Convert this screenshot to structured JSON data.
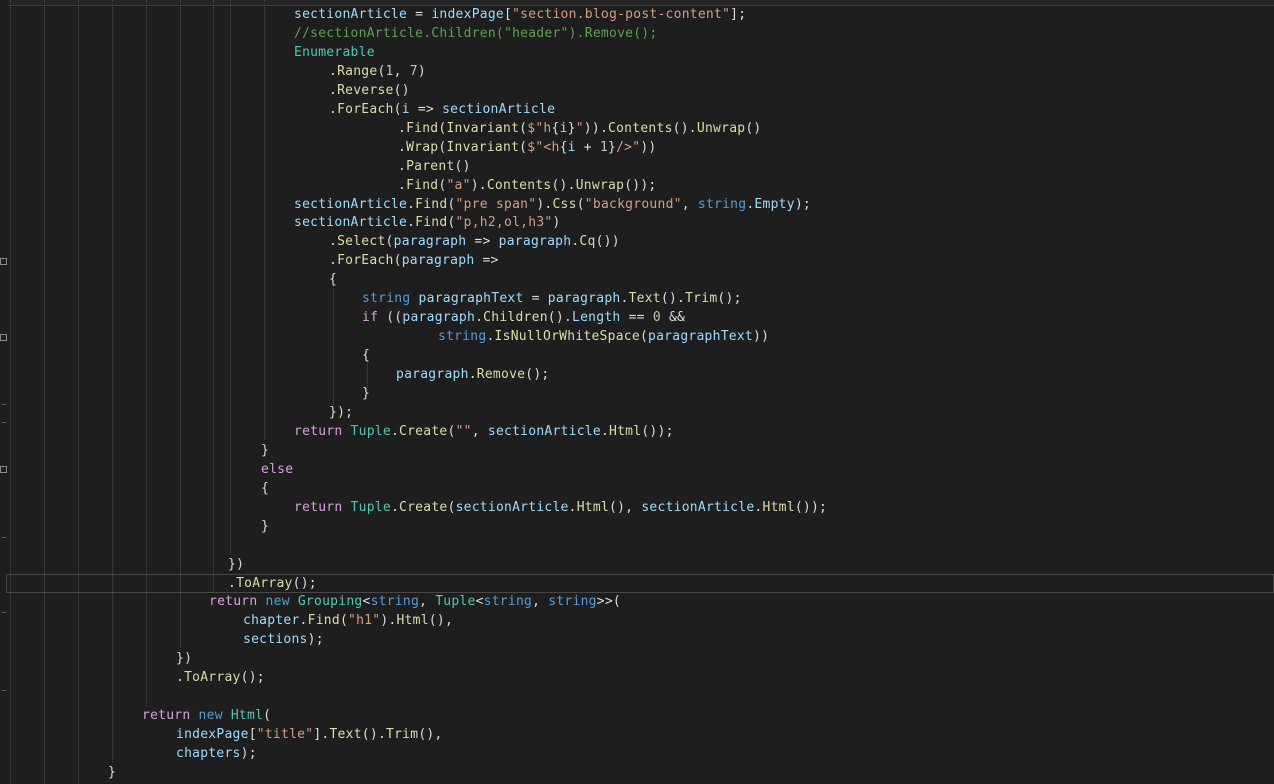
{
  "editor": {
    "theme": {
      "background": "#1e1e1e",
      "keyword": "#569cd6",
      "control": "#d8a0df",
      "string": "#d69d85",
      "comment": "#57a64a",
      "type": "#4ec9b0",
      "variable": "#9cdcfe",
      "method": "#dcdcaa",
      "number": "#b5cea8",
      "plain": "#dcdcdc"
    },
    "lines": [
      {
        "i": 0,
        "t": [
          [
            "var",
            "sectionArticle"
          ],
          [
            "p",
            " = "
          ],
          [
            "var",
            "indexPage"
          ],
          [
            "p",
            "["
          ],
          [
            "str",
            "\"section.blog-post-content\""
          ],
          [
            "p",
            "];"
          ]
        ]
      },
      {
        "i": 0,
        "t": [
          [
            "cmt",
            "//sectionArticle.Children(\"header\").Remove();"
          ]
        ]
      },
      {
        "i": 0,
        "t": [
          [
            "type",
            "Enumerable"
          ]
        ]
      },
      {
        "i": 1,
        "t": [
          [
            "p",
            "."
          ],
          [
            "meth",
            "Range"
          ],
          [
            "p",
            "("
          ],
          [
            "num",
            "1"
          ],
          [
            "p",
            ", "
          ],
          [
            "num",
            "7"
          ],
          [
            "p",
            ")"
          ]
        ]
      },
      {
        "i": 1,
        "t": [
          [
            "p",
            "."
          ],
          [
            "meth",
            "Reverse"
          ],
          [
            "p",
            "()"
          ]
        ]
      },
      {
        "i": 1,
        "t": [
          [
            "p",
            "."
          ],
          [
            "meth",
            "ForEach"
          ],
          [
            "p",
            "("
          ],
          [
            "var",
            "i"
          ],
          [
            "p",
            " => "
          ],
          [
            "var",
            "sectionArticle"
          ]
        ]
      },
      {
        "i": 2,
        "t": [
          [
            "p",
            "."
          ],
          [
            "meth",
            "Find"
          ],
          [
            "p",
            "("
          ],
          [
            "meth",
            "Invariant"
          ],
          [
            "p",
            "("
          ],
          [
            "str",
            "$\"h"
          ],
          [
            "p",
            "{"
          ],
          [
            "var",
            "i"
          ],
          [
            "p",
            "}"
          ],
          [
            "str",
            "\""
          ],
          [
            "p",
            "))."
          ],
          [
            "meth",
            "Contents"
          ],
          [
            "p",
            "()."
          ],
          [
            "meth",
            "Unwrap"
          ],
          [
            "p",
            "()"
          ]
        ]
      },
      {
        "i": 2,
        "t": [
          [
            "p",
            "."
          ],
          [
            "meth",
            "Wrap"
          ],
          [
            "p",
            "("
          ],
          [
            "meth",
            "Invariant"
          ],
          [
            "p",
            "("
          ],
          [
            "str",
            "$\"<h"
          ],
          [
            "p",
            "{"
          ],
          [
            "var",
            "i"
          ],
          [
            "p",
            " + "
          ],
          [
            "num",
            "1"
          ],
          [
            "p",
            "}"
          ],
          [
            "str",
            "/>\""
          ],
          [
            "p",
            "))"
          ]
        ]
      },
      {
        "i": 2,
        "t": [
          [
            "p",
            "."
          ],
          [
            "meth",
            "Parent"
          ],
          [
            "p",
            "()"
          ]
        ]
      },
      {
        "i": 2,
        "t": [
          [
            "p",
            "."
          ],
          [
            "meth",
            "Find"
          ],
          [
            "p",
            "("
          ],
          [
            "str",
            "\"a\""
          ],
          [
            "p",
            ")."
          ],
          [
            "meth",
            "Contents"
          ],
          [
            "p",
            "()."
          ],
          [
            "meth",
            "Unwrap"
          ],
          [
            "p",
            "());"
          ]
        ]
      },
      {
        "i": 0,
        "t": [
          [
            "var",
            "sectionArticle"
          ],
          [
            "p",
            "."
          ],
          [
            "meth",
            "Find"
          ],
          [
            "p",
            "("
          ],
          [
            "str",
            "\"pre span\""
          ],
          [
            "p",
            ")."
          ],
          [
            "meth",
            "Css"
          ],
          [
            "p",
            "("
          ],
          [
            "str",
            "\"background\""
          ],
          [
            "p",
            ", "
          ],
          [
            "kw",
            "string"
          ],
          [
            "p",
            "."
          ],
          [
            "var",
            "Empty"
          ],
          [
            "p",
            ");"
          ]
        ]
      },
      {
        "i": 0,
        "t": [
          [
            "var",
            "sectionArticle"
          ],
          [
            "p",
            "."
          ],
          [
            "meth",
            "Find"
          ],
          [
            "p",
            "("
          ],
          [
            "str",
            "\"p,h2,ol,h3\""
          ],
          [
            "p",
            ")"
          ]
        ]
      },
      {
        "i": 1,
        "t": [
          [
            "p",
            "."
          ],
          [
            "meth",
            "Select"
          ],
          [
            "p",
            "("
          ],
          [
            "var",
            "paragraph"
          ],
          [
            "p",
            " => "
          ],
          [
            "var",
            "paragraph"
          ],
          [
            "p",
            "."
          ],
          [
            "meth",
            "Cq"
          ],
          [
            "p",
            "())"
          ]
        ]
      },
      {
        "i": 1,
        "t": [
          [
            "p",
            "."
          ],
          [
            "meth",
            "ForEach"
          ],
          [
            "p",
            "("
          ],
          [
            "var",
            "paragraph"
          ],
          [
            "p",
            " =>"
          ]
        ]
      },
      {
        "i": 1,
        "t": [
          [
            "p",
            "{"
          ]
        ]
      },
      {
        "i": 3,
        "t": [
          [
            "kw",
            "string"
          ],
          [
            "p",
            " "
          ],
          [
            "var",
            "paragraphText"
          ],
          [
            "p",
            " = "
          ],
          [
            "var",
            "paragraph"
          ],
          [
            "p",
            "."
          ],
          [
            "meth",
            "Text"
          ],
          [
            "p",
            "()."
          ],
          [
            "meth",
            "Trim"
          ],
          [
            "p",
            "();"
          ]
        ]
      },
      {
        "i": 3,
        "t": [
          [
            "ctl",
            "if"
          ],
          [
            "p",
            " (("
          ],
          [
            "var",
            "paragraph"
          ],
          [
            "p",
            "."
          ],
          [
            "meth",
            "Children"
          ],
          [
            "p",
            "()."
          ],
          [
            "var",
            "Length"
          ],
          [
            "p",
            " == "
          ],
          [
            "num",
            "0"
          ],
          [
            "p",
            " &&"
          ]
        ]
      },
      {
        "i": 4,
        "t": [
          [
            "kw",
            "string"
          ],
          [
            "p",
            "."
          ],
          [
            "meth",
            "IsNullOrWhiteSpace"
          ],
          [
            "p",
            "("
          ],
          [
            "var",
            "paragraphText"
          ],
          [
            "p",
            "))"
          ]
        ]
      },
      {
        "i": 3,
        "t": [
          [
            "p",
            "{"
          ]
        ]
      },
      {
        "i": 5,
        "t": [
          [
            "var",
            "paragraph"
          ],
          [
            "p",
            "."
          ],
          [
            "meth",
            "Remove"
          ],
          [
            "p",
            "();"
          ]
        ]
      },
      {
        "i": 3,
        "t": [
          [
            "p",
            "}"
          ]
        ]
      },
      {
        "i": 1,
        "t": [
          [
            "p",
            "});"
          ]
        ]
      },
      {
        "i": 0,
        "t": [
          [
            "ctl",
            "return"
          ],
          [
            "p",
            " "
          ],
          [
            "type",
            "Tuple"
          ],
          [
            "p",
            "."
          ],
          [
            "meth",
            "Create"
          ],
          [
            "p",
            "("
          ],
          [
            "str",
            "\"\""
          ],
          [
            "p",
            ", "
          ],
          [
            "var",
            "sectionArticle"
          ],
          [
            "p",
            "."
          ],
          [
            "meth",
            "Html"
          ],
          [
            "p",
            "());"
          ]
        ]
      },
      {
        "i": 6,
        "t": [
          [
            "p",
            "}"
          ]
        ]
      },
      {
        "i": 6,
        "t": [
          [
            "ctl",
            "else"
          ]
        ]
      },
      {
        "i": 6,
        "t": [
          [
            "p",
            "{"
          ]
        ]
      },
      {
        "i": 0,
        "t": [
          [
            "ctl",
            "return"
          ],
          [
            "p",
            " "
          ],
          [
            "type",
            "Tuple"
          ],
          [
            "p",
            "."
          ],
          [
            "meth",
            "Create"
          ],
          [
            "p",
            "("
          ],
          [
            "var",
            "sectionArticle"
          ],
          [
            "p",
            "."
          ],
          [
            "meth",
            "Html"
          ],
          [
            "p",
            "(), "
          ],
          [
            "var",
            "sectionArticle"
          ],
          [
            "p",
            "."
          ],
          [
            "meth",
            "Html"
          ],
          [
            "p",
            "());"
          ]
        ]
      },
      {
        "i": 6,
        "t": [
          [
            "p",
            "}"
          ]
        ]
      },
      {
        "i": -1,
        "t": []
      },
      {
        "i": 7,
        "t": [
          [
            "p",
            "})"
          ]
        ]
      },
      {
        "i": 7,
        "t": [
          [
            "p",
            "."
          ],
          [
            "meth",
            "ToArray"
          ],
          [
            "p",
            "();"
          ]
        ]
      },
      {
        "i": 8,
        "t": [
          [
            "ctl",
            "return"
          ],
          [
            "p",
            " "
          ],
          [
            "kw",
            "new"
          ],
          [
            "p",
            " "
          ],
          [
            "type",
            "Grouping"
          ],
          [
            "p",
            "<"
          ],
          [
            "kw",
            "string"
          ],
          [
            "p",
            ", "
          ],
          [
            "type",
            "Tuple"
          ],
          [
            "p",
            "<"
          ],
          [
            "kw",
            "string"
          ],
          [
            "p",
            ", "
          ],
          [
            "kw",
            "string"
          ],
          [
            "p",
            ">>("
          ]
        ]
      },
      {
        "i": 9,
        "t": [
          [
            "var",
            "chapter"
          ],
          [
            "p",
            "."
          ],
          [
            "meth",
            "Find"
          ],
          [
            "p",
            "("
          ],
          [
            "str",
            "\"h1\""
          ],
          [
            "p",
            ")."
          ],
          [
            "meth",
            "Html"
          ],
          [
            "p",
            "(),"
          ]
        ]
      },
      {
        "i": 9,
        "t": [
          [
            "var",
            "sections"
          ],
          [
            "p",
            ");"
          ]
        ]
      },
      {
        "i": 10,
        "t": [
          [
            "p",
            "})"
          ]
        ]
      },
      {
        "i": 10,
        "t": [
          [
            "p",
            "."
          ],
          [
            "meth",
            "ToArray"
          ],
          [
            "p",
            "();"
          ]
        ]
      },
      {
        "i": -1,
        "t": []
      },
      {
        "i": 11,
        "t": [
          [
            "ctl",
            "return"
          ],
          [
            "p",
            " "
          ],
          [
            "kw",
            "new"
          ],
          [
            "p",
            " "
          ],
          [
            "type",
            "Html"
          ],
          [
            "p",
            "("
          ]
        ]
      },
      {
        "i": 10,
        "t": [
          [
            "var",
            "indexPage"
          ],
          [
            "p",
            "["
          ],
          [
            "str",
            "\"title\""
          ],
          [
            "p",
            "]."
          ],
          [
            "meth",
            "Text"
          ],
          [
            "p",
            "()."
          ],
          [
            "meth",
            "Trim"
          ],
          [
            "p",
            "(),"
          ]
        ]
      },
      {
        "i": 10,
        "t": [
          [
            "var",
            "chapters"
          ],
          [
            "p",
            ");"
          ]
        ]
      },
      {
        "i": 12,
        "t": [
          [
            "p",
            "}"
          ]
        ]
      }
    ]
  }
}
